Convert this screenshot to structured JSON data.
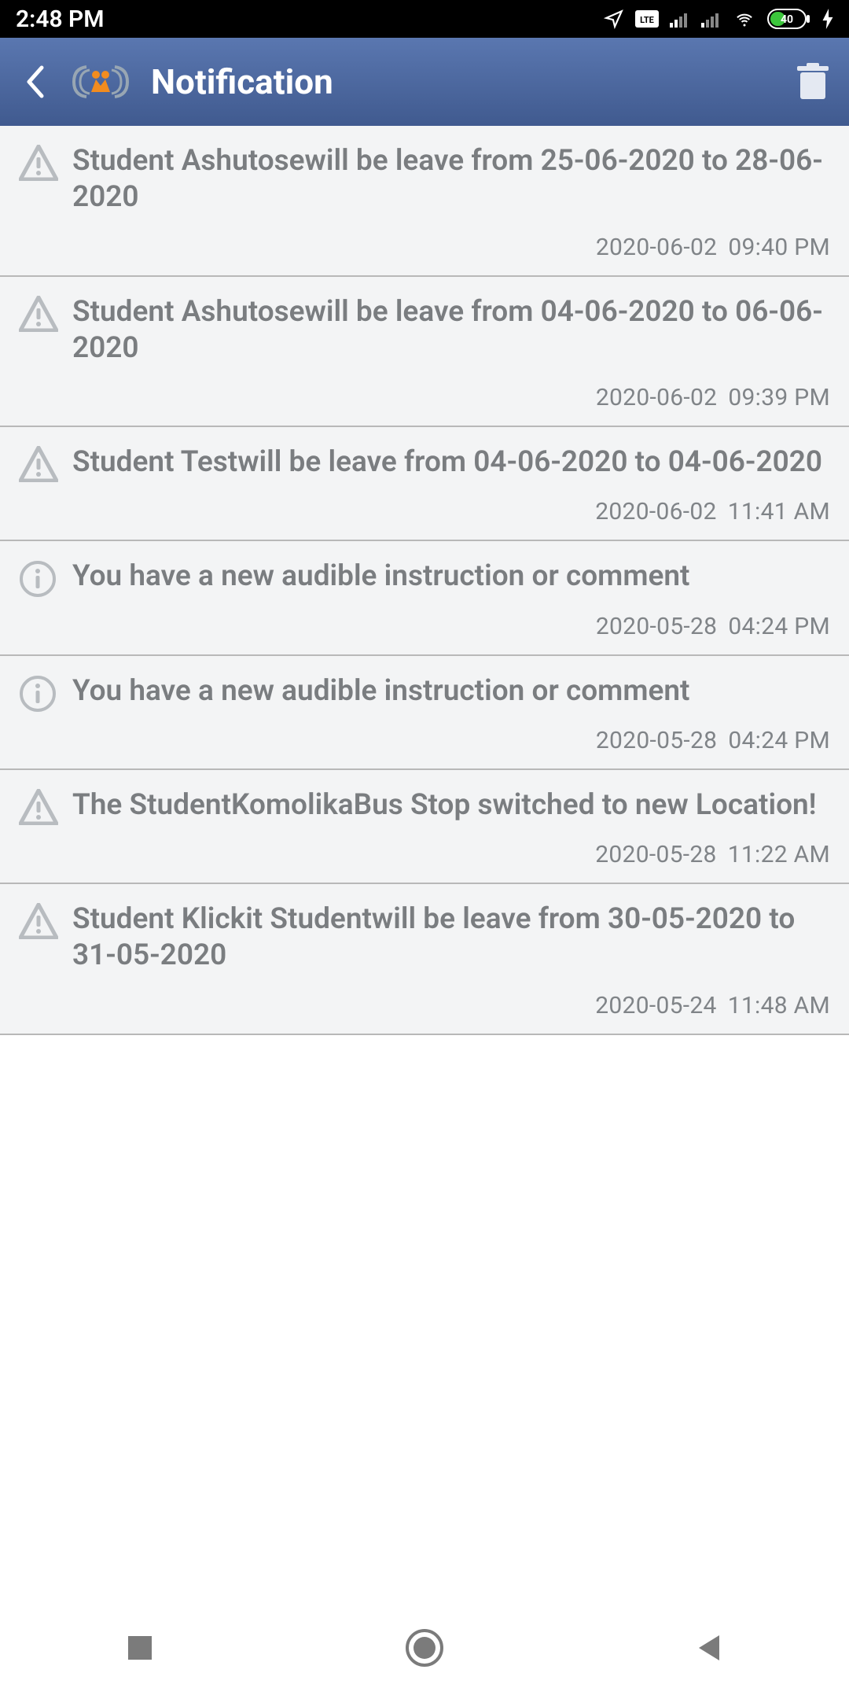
{
  "status": {
    "time": "2:48 PM",
    "battery": "40"
  },
  "header": {
    "title": "Notification"
  },
  "notifications": [
    {
      "icon": "warning",
      "message": "Student Ashutosewill be leave from 25-06-2020 to 28-06-2020",
      "date": "2020-06-02",
      "time": "09:40 PM"
    },
    {
      "icon": "warning",
      "message": "Student Ashutosewill be leave from 04-06-2020 to 06-06-2020",
      "date": "2020-06-02",
      "time": "09:39 PM"
    },
    {
      "icon": "warning",
      "message": "Student Testwill be leave from 04-06-2020 to 04-06-2020",
      "date": "2020-06-02",
      "time": "11:41 AM"
    },
    {
      "icon": "info",
      "message": "You have a new audible instruction or comment",
      "date": "2020-05-28",
      "time": "04:24 PM"
    },
    {
      "icon": "info",
      "message": "You have a new audible instruction or comment",
      "date": "2020-05-28",
      "time": "04:24 PM"
    },
    {
      "icon": "warning",
      "message": "The StudentKomolikaBus Stop switched to new Location!",
      "date": "2020-05-28",
      "time": "11:22 AM"
    },
    {
      "icon": "warning",
      "message": "Student Klickit Studentwill be leave from 30-05-2020 to 31-05-2020",
      "date": "2020-05-24",
      "time": "11:48 AM"
    }
  ]
}
